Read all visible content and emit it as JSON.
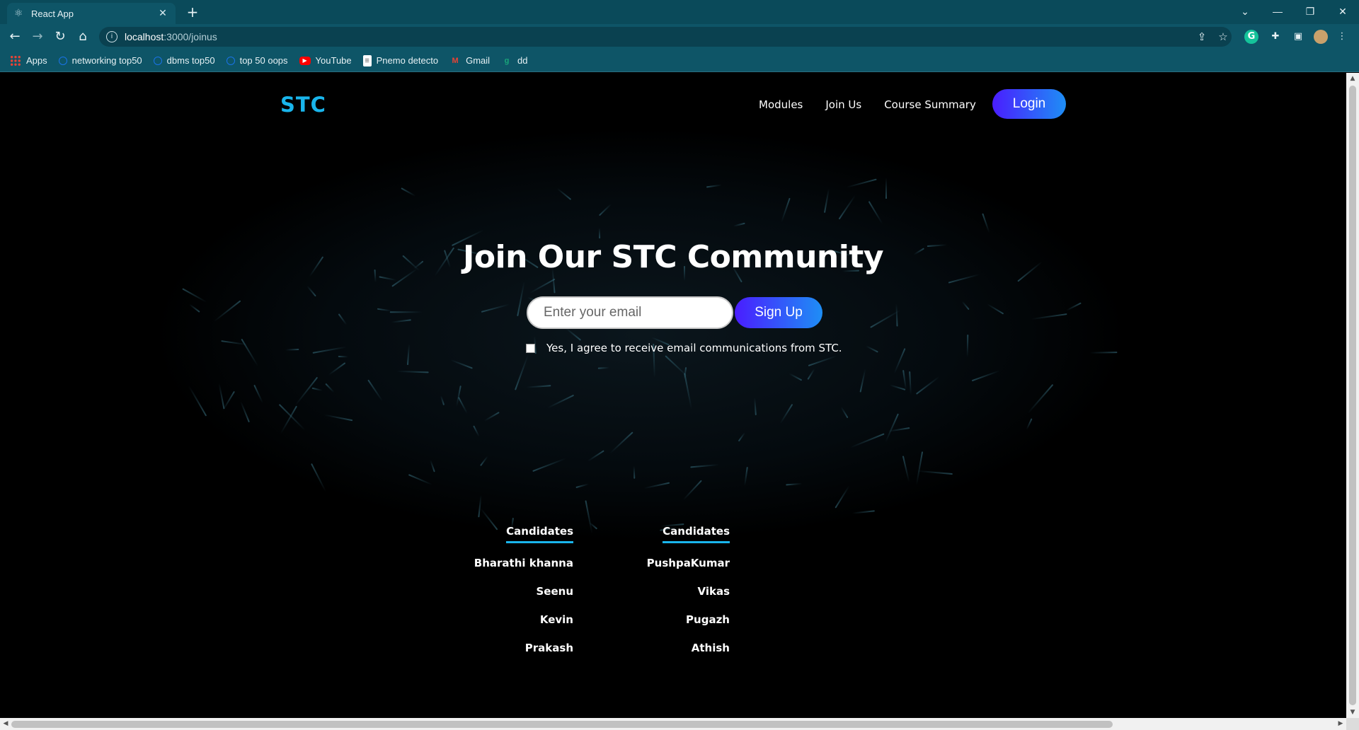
{
  "browser": {
    "tab_title": "React App",
    "url_host": "localhost",
    "url_path": ":3000/joinus",
    "bookmarks": [
      {
        "label": "Apps",
        "icon": "apps-grid-icon"
      },
      {
        "label": "networking top50",
        "icon": "globe-icon"
      },
      {
        "label": "dbms top50",
        "icon": "globe-icon"
      },
      {
        "label": "top 50 oops",
        "icon": "globe-icon"
      },
      {
        "label": "YouTube",
        "icon": "youtube-icon"
      },
      {
        "label": "Pnemo detecto",
        "icon": "document-icon"
      },
      {
        "label": "Gmail",
        "icon": "gmail-icon"
      },
      {
        "label": "dd",
        "icon": "grammarly-icon"
      }
    ]
  },
  "nav": {
    "logo": "STC",
    "links": [
      "Modules",
      "Join Us",
      "Course Summary"
    ],
    "login_label": "Login"
  },
  "hero": {
    "title": "Join Our STC Community",
    "email_placeholder": "Enter your email",
    "signup_label": "Sign Up",
    "consent_text": "Yes, I agree to receive email communications from STC."
  },
  "candidates": [
    {
      "heading": "Candidates",
      "names": [
        "Bharathi khanna",
        "Seenu",
        "Kevin",
        "Prakash"
      ]
    },
    {
      "heading": "Candidates",
      "names": [
        "PushpaKumar",
        "Vikas",
        "Pugazh",
        "Athish"
      ]
    }
  ],
  "colors": {
    "browser_chrome": "#0e5567",
    "logo_accent": "#19b5ec",
    "button_gradient_start": "#4a1dff",
    "button_gradient_end": "#1e8ef5",
    "page_background": "#000000"
  }
}
